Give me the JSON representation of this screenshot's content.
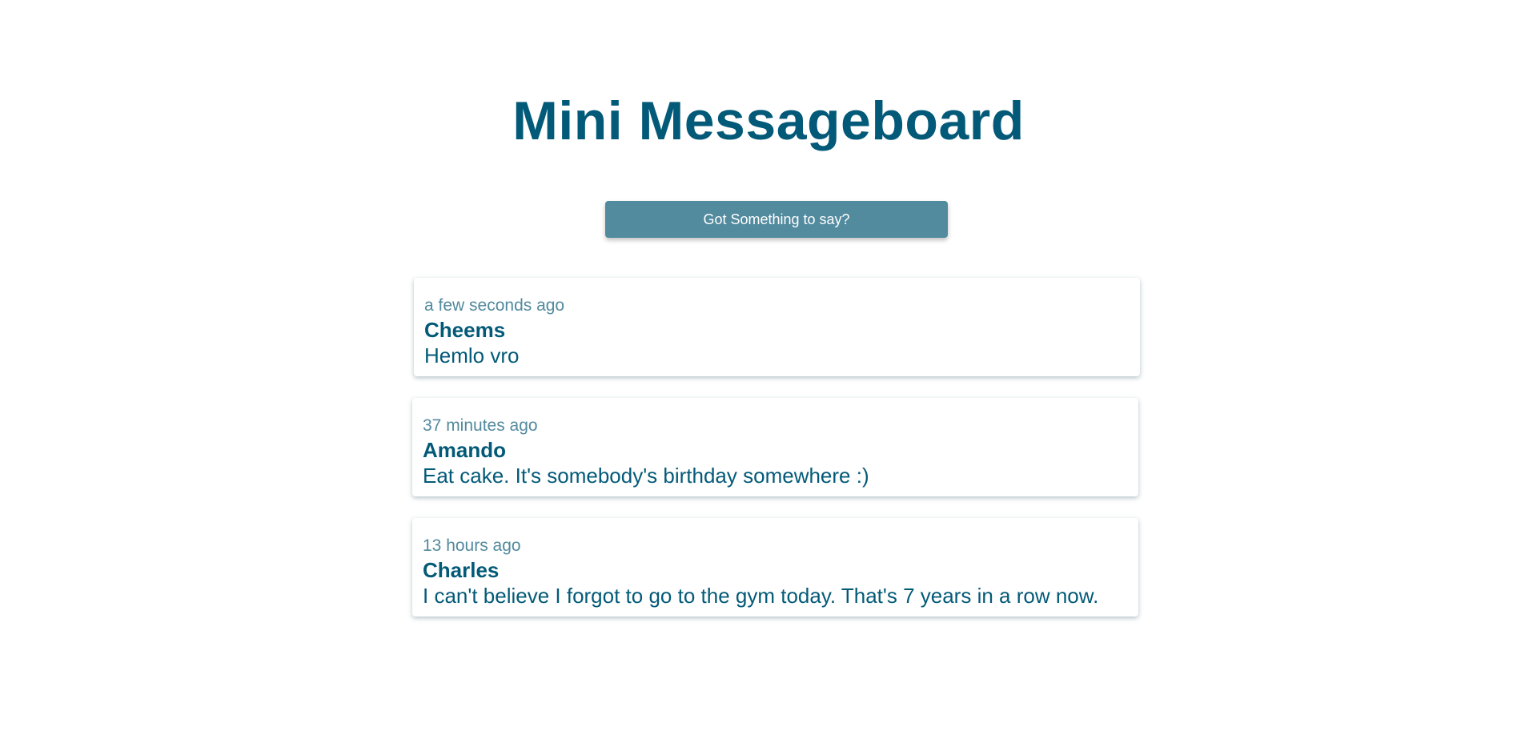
{
  "header": {
    "title": "Mini Messageboard"
  },
  "actions": {
    "compose_label": "Got Something to say?"
  },
  "messages": [
    {
      "time": "a few seconds ago",
      "author": "Cheems",
      "text": "Hemlo vro"
    },
    {
      "time": "37 minutes ago",
      "author": "Amando",
      "text": "Eat cake. It's somebody's birthday somewhere :)"
    },
    {
      "time": "13 hours ago",
      "author": "Charles",
      "text": "I can't believe I forgot to go to the gym today. That's 7 years in a row now."
    }
  ],
  "colors": {
    "primary": "#035a78",
    "muted": "#528a9e",
    "button_bg": "#528a9e",
    "background": "#ffffff"
  }
}
